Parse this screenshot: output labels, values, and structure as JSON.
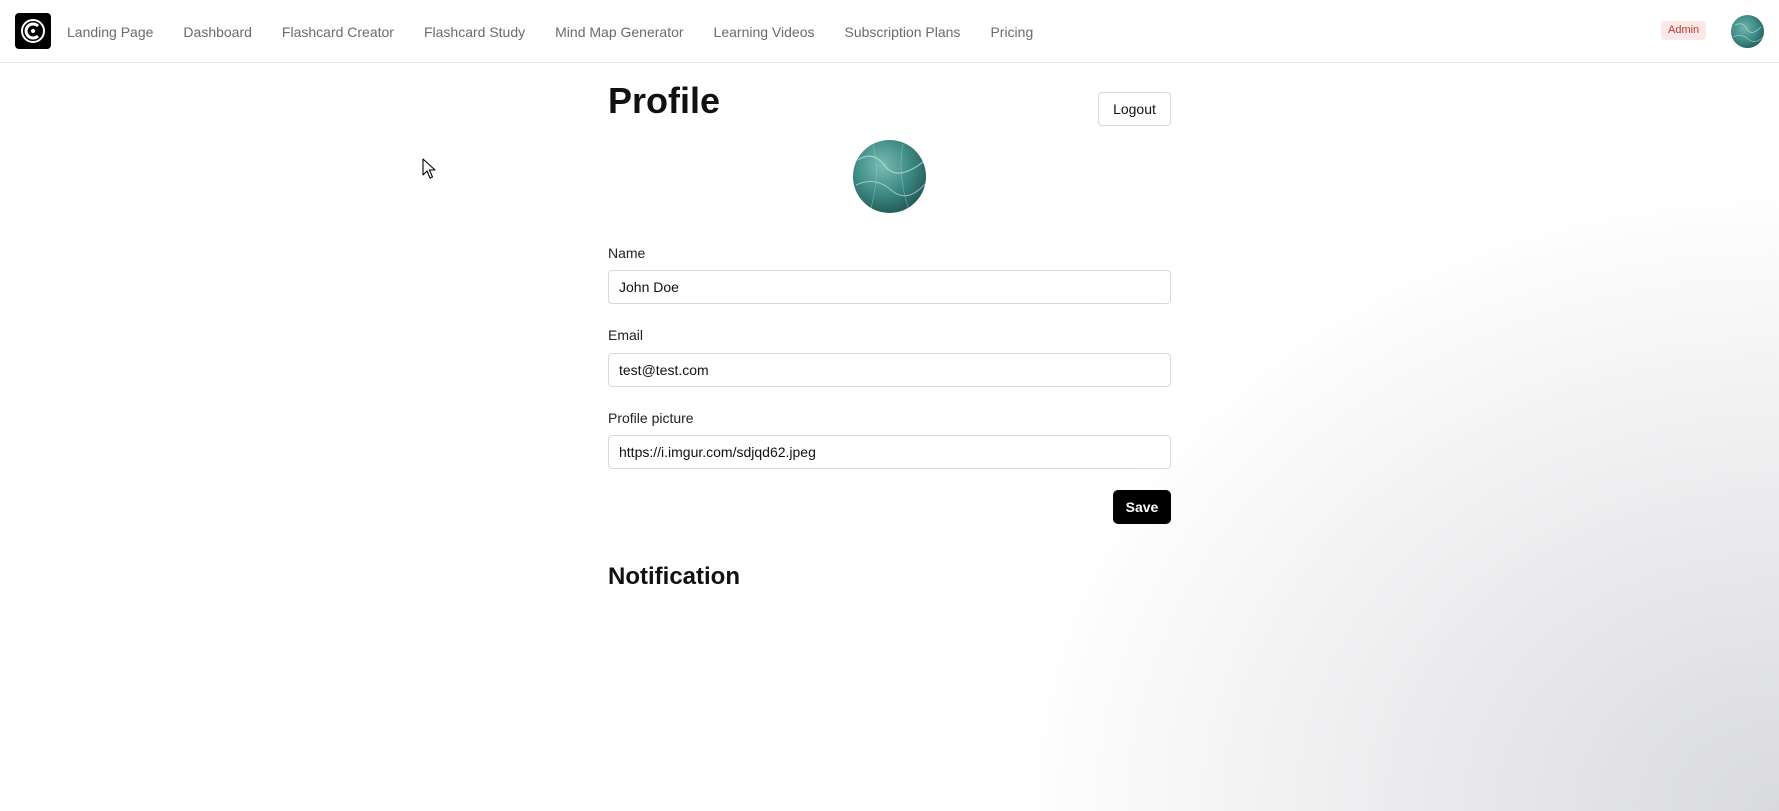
{
  "nav": {
    "logo_icon": "brand-logo-icon",
    "links": [
      {
        "label": "Landing Page"
      },
      {
        "label": "Dashboard"
      },
      {
        "label": "Flashcard Creator"
      },
      {
        "label": "Flashcard Study"
      },
      {
        "label": "Mind Map Generator"
      },
      {
        "label": "Learning Videos"
      },
      {
        "label": "Subscription Plans"
      },
      {
        "label": "Pricing"
      }
    ],
    "admin_badge": "Admin"
  },
  "profile": {
    "title": "Profile",
    "logout_label": "Logout",
    "fields": {
      "name": {
        "label": "Name",
        "value": "John Doe"
      },
      "email": {
        "label": "Email",
        "value": "test@test.com"
      },
      "picture": {
        "label": "Profile picture",
        "value": "https://i.imgur.com/sdjqd62.jpeg"
      }
    },
    "save_label": "Save"
  },
  "notification": {
    "title": "Notification"
  },
  "colors": {
    "accent": "#000000",
    "badge_bg": "#fde8e8",
    "badge_text": "#c0392b",
    "avatar_teal": "#3f8c87"
  }
}
